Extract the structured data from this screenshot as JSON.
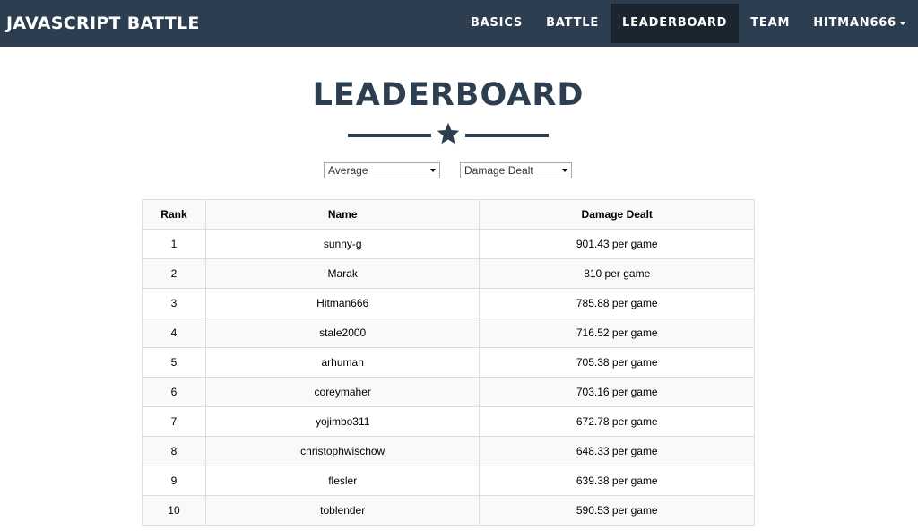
{
  "navbar": {
    "brand": "JAVASCRIPT BATTLE",
    "items": [
      {
        "label": "BASICS",
        "active": false
      },
      {
        "label": "BATTLE",
        "active": false
      },
      {
        "label": "LEADERBOARD",
        "active": true
      },
      {
        "label": "TEAM",
        "active": false
      }
    ],
    "user": "HITMAN666",
    "colors": {
      "bg": "#2c3e50",
      "active": "#1a252f"
    }
  },
  "page": {
    "title": "LEADERBOARD",
    "divider_icon": "star-icon"
  },
  "filters": {
    "period": "Average",
    "stat": "Damage Dealt"
  },
  "table": {
    "headers": [
      "Rank",
      "Name",
      "Damage Dealt"
    ],
    "rows": [
      {
        "rank": "1",
        "name": "sunny-g",
        "value": "901.43 per game"
      },
      {
        "rank": "2",
        "name": "Marak",
        "value": "810 per game"
      },
      {
        "rank": "3",
        "name": "Hitman666",
        "value": "785.88 per game"
      },
      {
        "rank": "4",
        "name": "stale2000",
        "value": "716.52 per game"
      },
      {
        "rank": "5",
        "name": "arhuman",
        "value": "705.38 per game"
      },
      {
        "rank": "6",
        "name": "coreymaher",
        "value": "703.16 per game"
      },
      {
        "rank": "7",
        "name": "yojimbo311",
        "value": "672.78 per game"
      },
      {
        "rank": "8",
        "name": "christophwischow",
        "value": "648.33 per game"
      },
      {
        "rank": "9",
        "name": "flesler",
        "value": "639.38 per game"
      },
      {
        "rank": "10",
        "name": "toblender",
        "value": "590.53 per game"
      }
    ]
  }
}
